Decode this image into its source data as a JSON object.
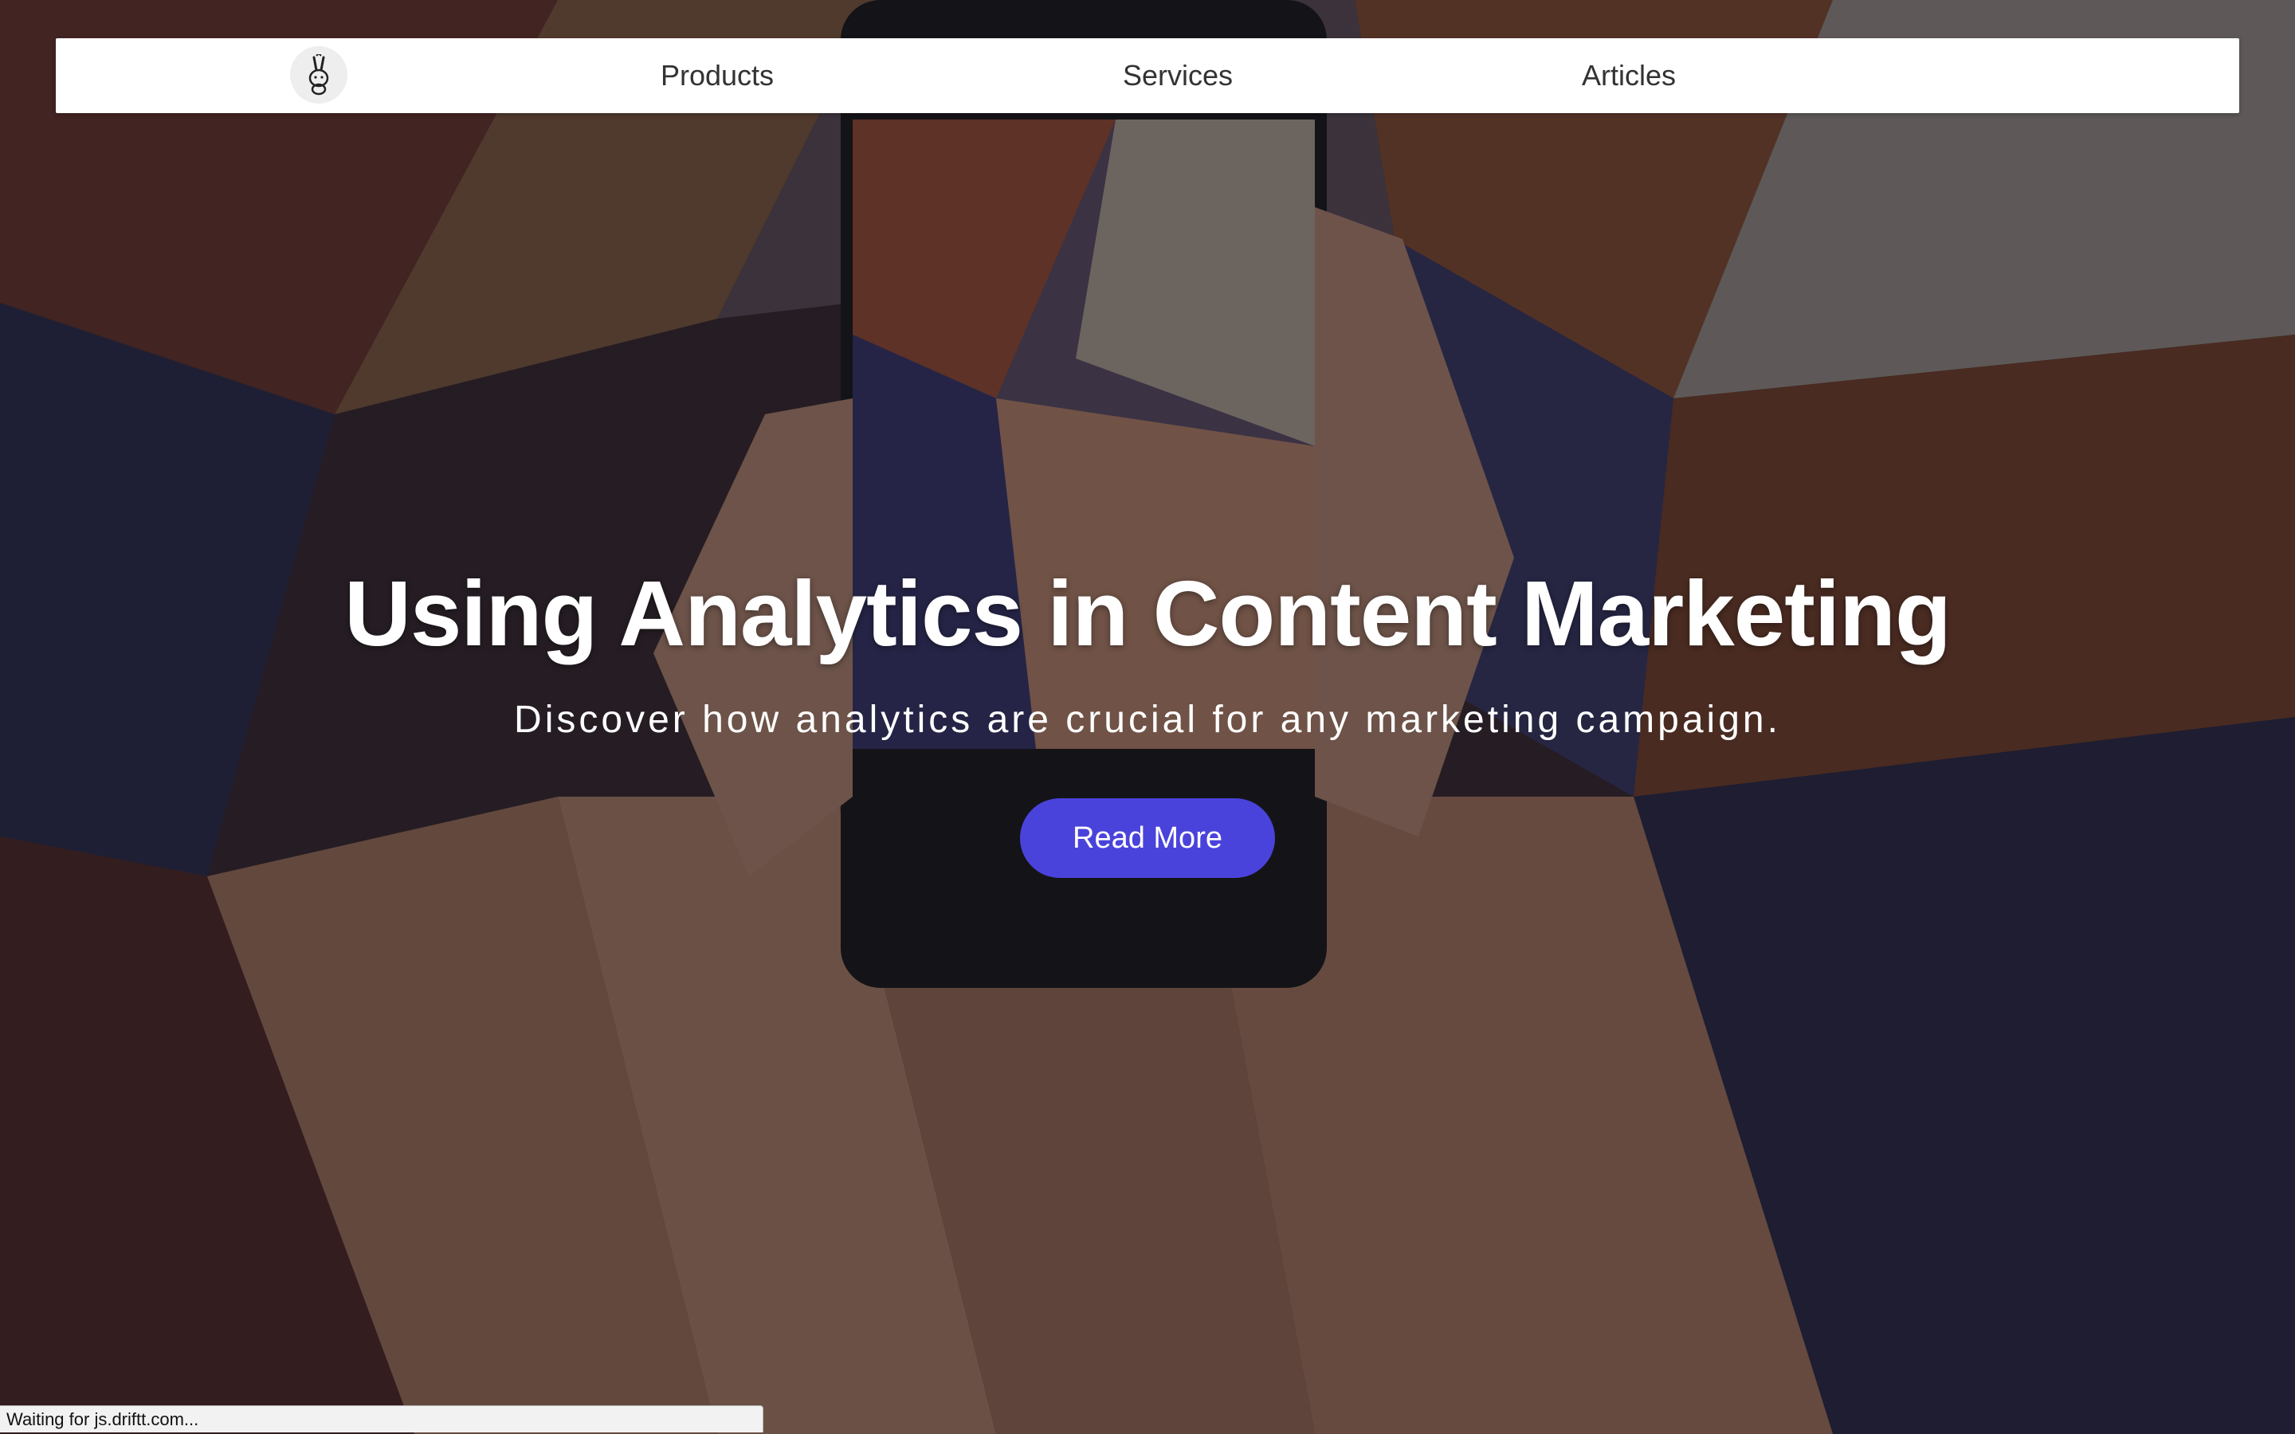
{
  "nav": {
    "logo_icon": "rabbit-logo-icon",
    "links": [
      {
        "label": "Products"
      },
      {
        "label": "Services"
      },
      {
        "label": "Articles"
      }
    ]
  },
  "hero": {
    "title": "Using Analytics in Content Marketing",
    "subtitle": "Discover how analytics are crucial for any marketing campaign.",
    "cta_label": "Read More",
    "accent_color": "#4a43db",
    "background_image": "hands-holding-phone-photographing-graffiti-mural"
  },
  "status_bar": {
    "text": "Waiting for js.driftt.com..."
  }
}
